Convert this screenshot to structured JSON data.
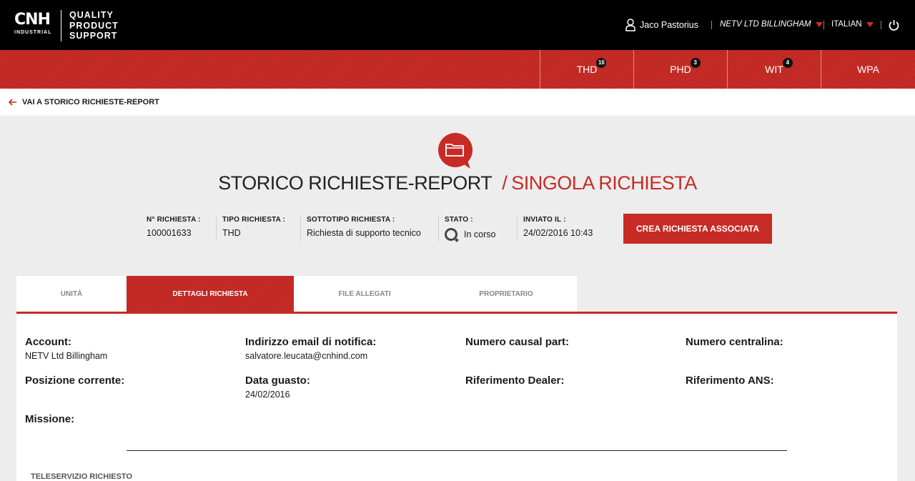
{
  "header": {
    "logo_main": "CNH",
    "logo_sub": "INDUSTRIAL",
    "brand_line1": "QUALITY",
    "brand_line2": "PRODUCT",
    "brand_line3": "SUPPORT",
    "user_name": "Jaco Pastorius",
    "dealer": "NETV LTD BILLINGHAM",
    "language": "ITALIAN"
  },
  "nav": {
    "tabs": [
      {
        "label": "THD",
        "badge": "16"
      },
      {
        "label": "PHD",
        "badge": "3"
      },
      {
        "label": "WIT",
        "badge": "4"
      },
      {
        "label": "WPA"
      }
    ]
  },
  "back_link": "VAI A STORICO RICHIESTE-REPORT",
  "title": {
    "part1": "STORICO RICHIESTE-REPORT",
    "separator": "/",
    "part2": "SINGOLA RICHIESTA"
  },
  "meta": {
    "request_number_label": "N° RICHIESTA :",
    "request_number": "100001633",
    "type_label": "TIPO RICHIESTA :",
    "type": "THD",
    "subtype_label": "SOTTOTIPO RICHIESTA :",
    "subtype": "Richiesta di supporto tecnico",
    "status_label": "STATO :",
    "status": "In corso",
    "sent_label": "INVIATO IL :",
    "sent": "24/02/2016 10:43"
  },
  "create_button": "CREA RICHIESTA ASSOCIATA",
  "tabs": {
    "unita": "UNITÀ",
    "dettagli": "DETTAGLI RICHIESTA",
    "file": "FILE ALLEGATI",
    "proprietario": "PROPRIETARIO",
    "active": "DETTAGLI RICHIESTA"
  },
  "details": {
    "account_label": "Account:",
    "account_value": "NETV Ltd Billingham",
    "email_label": "Indirizzo email di notifica:",
    "email_value": "salvatore.leucata@cnhind.com",
    "causal_label": "Numero causal part:",
    "centralina_label": "Numero centralina:",
    "posizione_label": "Posizione corrente:",
    "data_label": "Data guasto:",
    "data_value": "24/02/2016",
    "dealer_ref_label": "Riferimento Dealer:",
    "ans_ref_label": "Riferimento ANS:",
    "missione_label": "Missione:"
  },
  "section_title": "TELESERVIZIO RICHIESTO",
  "colors": {
    "brand_red": "#c62b26",
    "header_black": "#000000"
  },
  "icons": {
    "user": "user-icon",
    "power": "power-icon",
    "back": "arrow-left-icon",
    "folder": "folder-icon",
    "status": "spinner-icon"
  }
}
